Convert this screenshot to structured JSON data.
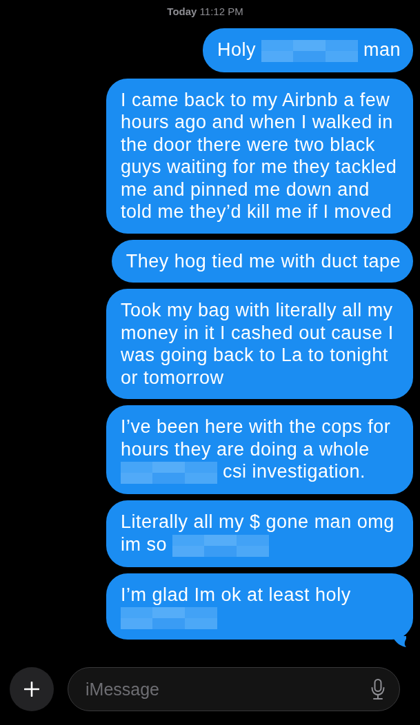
{
  "timestamp": "**Today** 11:12 PM",
  "messages": [
    {
      "tail": false,
      "segments": [
        {
          "kind": "text",
          "text": "Holy"
        },
        {
          "kind": "redacted"
        },
        {
          "kind": "text",
          "text": "man"
        }
      ]
    },
    {
      "tail": false,
      "segments": [
        {
          "kind": "text",
          "text": "I came back to my Airbnb a few hours ago and when I walked in the door there were two black guys waiting for me they tackled me and pinned me down and told me they’d kill me if I moved"
        }
      ]
    },
    {
      "tail": false,
      "segments": [
        {
          "kind": "text",
          "text": "They hog tied me with duct tape"
        }
      ]
    },
    {
      "tail": false,
      "segments": [
        {
          "kind": "text",
          "text": "Took my bag with literally all my money in it I cashed out cause I was going back to La to tonight or tomorrow"
        }
      ]
    },
    {
      "tail": false,
      "segments": [
        {
          "kind": "text",
          "text": "I’ve been here with the cops for hours they are doing a whole"
        },
        {
          "kind": "redacted"
        },
        {
          "kind": "text",
          "text": "csi investigation."
        }
      ]
    },
    {
      "tail": false,
      "segments": [
        {
          "kind": "text",
          "text": "Literally all my $ gone man omg"
        },
        {
          "kind": "text",
          "text": "im so"
        },
        {
          "kind": "redacted"
        }
      ]
    },
    {
      "tail": true,
      "segments": [
        {
          "kind": "text",
          "text": "I’m glad Im ok at least holy"
        },
        {
          "kind": "redacted"
        }
      ]
    }
  ],
  "composer": {
    "placeholder": "iMessage"
  }
}
